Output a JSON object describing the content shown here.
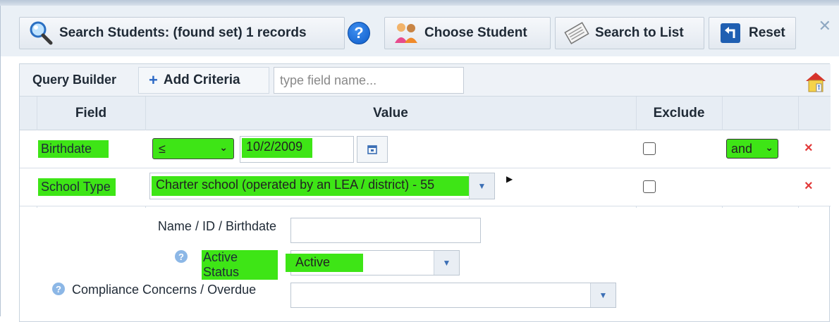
{
  "toolbar": {
    "search_label": "Search Students: (found set) 1 records",
    "help_label": "?",
    "choose_student_label": "Choose Student",
    "search_to_list_label": "Search to List",
    "reset_label": "Reset"
  },
  "query_builder": {
    "title": "Query Builder",
    "add_criteria_label": "Add Criteria",
    "field_search_placeholder": "type field name..."
  },
  "grid": {
    "headers": {
      "field": "Field",
      "value": "Value",
      "exclude": "Exclude"
    },
    "rows": [
      {
        "field": "Birthdate",
        "operator": "≤",
        "value": "10/2/2009",
        "conjunction": "and",
        "remove": "×"
      },
      {
        "field": "School Type",
        "value": "Charter school (operated by an LEA / district) - 55",
        "remove": "×"
      }
    ]
  },
  "filters": {
    "name_label": "Name / ID / Birthdate",
    "name_value": "",
    "active_status_label": "Active Status",
    "active_status_value": "Active",
    "compliance_label": "Compliance Concerns / Overdue",
    "compliance_value": ""
  },
  "colors": {
    "highlight": "#3ee516",
    "header_bg": "#eaf0f6",
    "remove_red": "#e23a3a"
  }
}
